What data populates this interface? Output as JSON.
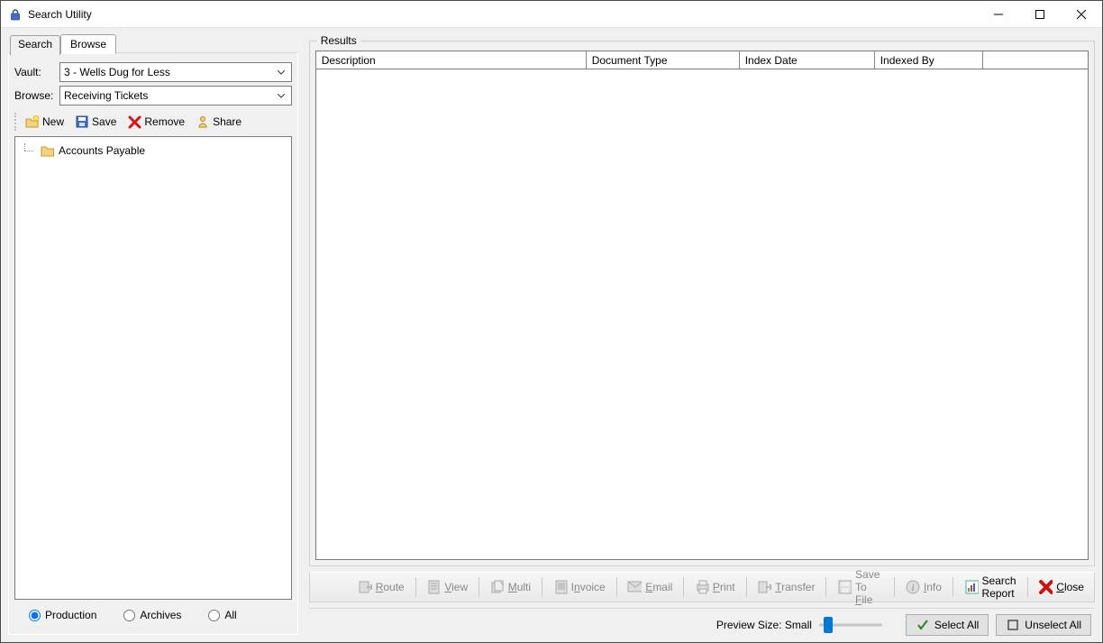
{
  "window": {
    "title": "Search Utility"
  },
  "tabs": {
    "search": "Search",
    "browse": "Browse"
  },
  "browse_panel": {
    "vault_label": "Vault:",
    "vault_value": "3 - Wells Dug for Less",
    "browse_label": "Browse:",
    "browse_value": "Receiving Tickets",
    "toolbar": {
      "new": "New",
      "save": "Save",
      "remove": "Remove",
      "share": "Share"
    },
    "tree": {
      "node0": "Accounts Payable"
    },
    "radios": {
      "production": "Production",
      "archives": "Archives",
      "all": "All"
    }
  },
  "results": {
    "title": "Results",
    "columns": {
      "description": "Description",
      "document_type": "Document Type",
      "index_date": "Index Date",
      "indexed_by": "Indexed By"
    }
  },
  "actions": {
    "route": "Route",
    "view": "View",
    "multi": "Multi",
    "invoice": "Invoice",
    "email": "Email",
    "print": "Print",
    "transfer": "Transfer",
    "save_to_file": "Save To File",
    "info": "Info",
    "search_report": "Search Report",
    "close": "Close"
  },
  "preview": {
    "label": "Preview Size: Small",
    "select_all": "Select All",
    "unselect_all": "Unselect All"
  }
}
